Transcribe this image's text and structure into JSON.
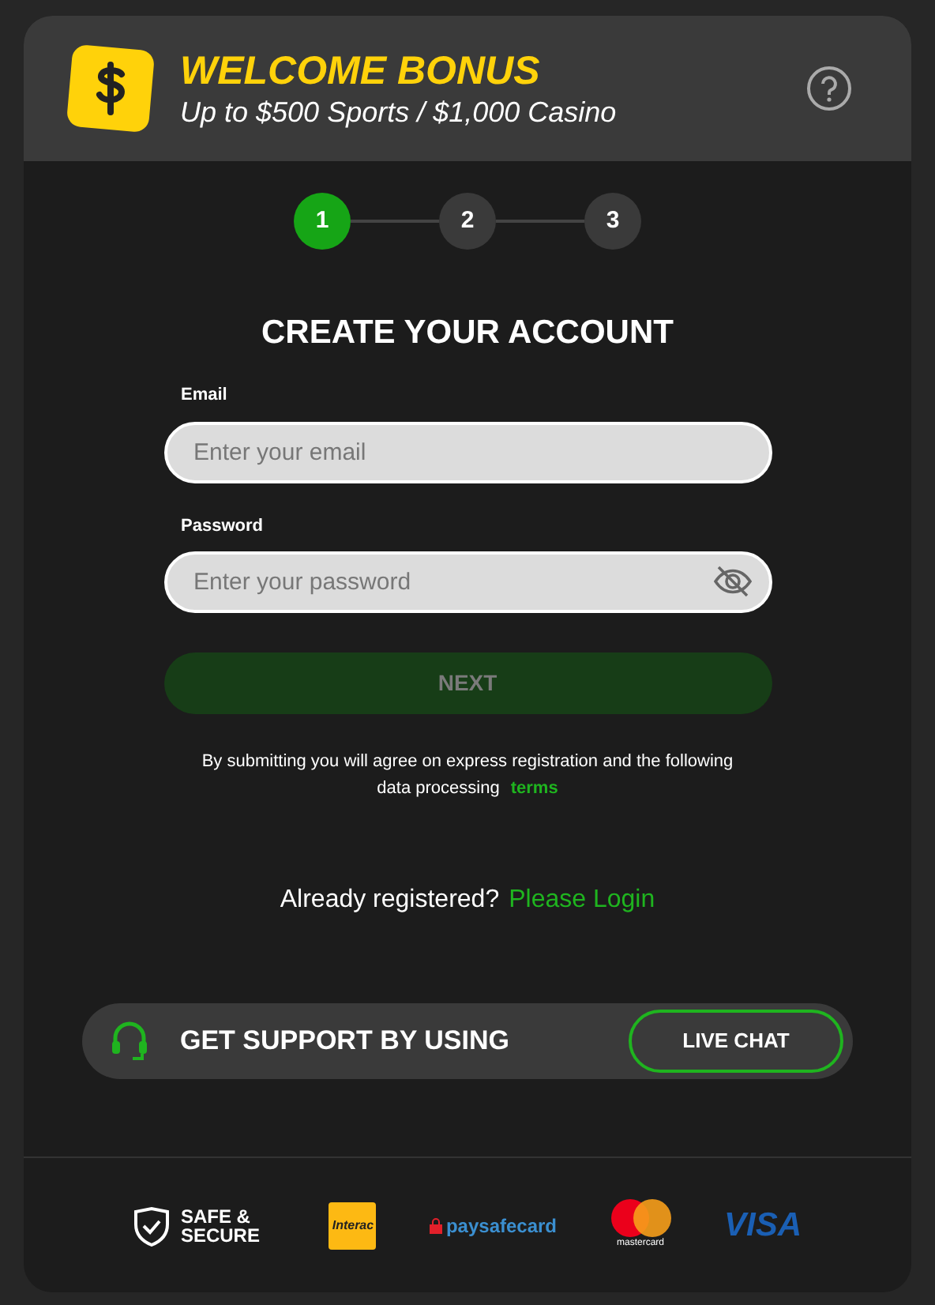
{
  "header": {
    "title": "WELCOME BONUS",
    "subtitle": "Up to $500 Sports / $1,000 Casino"
  },
  "steps": [
    {
      "label": "1",
      "selected": true
    },
    {
      "label": "2",
      "selected": false
    },
    {
      "label": "3",
      "selected": false
    }
  ],
  "form": {
    "title": "CREATE YOUR ACCOUNT",
    "fields": [
      {
        "label": "Email",
        "placeholder": "Enter your email",
        "kind": "text"
      },
      {
        "label": "Password",
        "placeholder": "Enter your password",
        "kind": "password"
      }
    ],
    "submit": {
      "label": "NEXT",
      "disabled": true
    },
    "terms": {
      "text": "By submitting you will agree on express registration and the following data processing",
      "link": "terms"
    },
    "login": {
      "text": "Already registered?",
      "link": "Please Login"
    }
  },
  "support": {
    "text": "GET SUPPORT BY USING",
    "button": "LIVE CHAT"
  },
  "footer": {
    "safe": "SAFE & SECURE",
    "logos": [
      {
        "kind": "interac",
        "text": "Interac"
      },
      {
        "kind": "paysafecard",
        "text": "paysafecard"
      },
      {
        "kind": "mastercard",
        "text": "mastercard"
      },
      {
        "kind": "visa",
        "text": "VISA"
      }
    ]
  }
}
